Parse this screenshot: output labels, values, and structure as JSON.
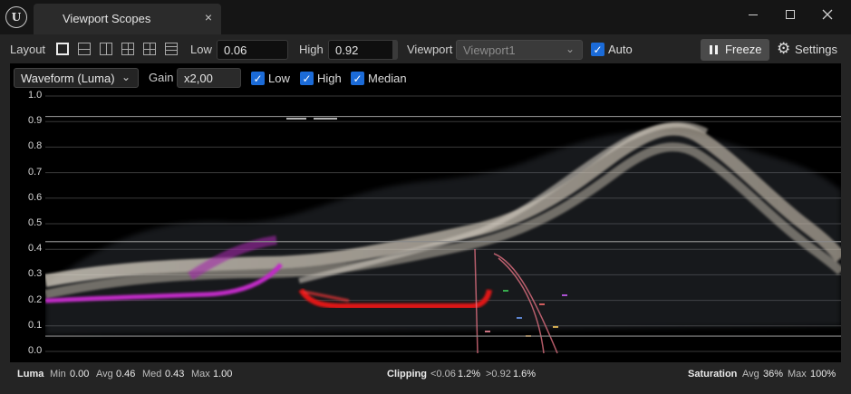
{
  "window": {
    "app_logo": "U",
    "tab_title": "Viewport Scopes",
    "tab_close": "×",
    "controls": [
      "minimize-icon",
      "maximize-icon",
      "close-icon"
    ]
  },
  "toolbar": {
    "layout_label": "Layout",
    "layout_icons": [
      "layout-single-icon",
      "layout-horizontal-split-icon",
      "layout-vertical-split-icon",
      "layout-quad-icon",
      "layout-grid-icon",
      "layout-rows-icon"
    ],
    "low_label": "Low",
    "low_value": "0.06",
    "high_label": "High",
    "high_value": "0.92",
    "viewport_label": "Viewport",
    "viewport_value": "Viewport1",
    "auto_label": "Auto",
    "auto_checked": true,
    "freeze_label": "Freeze",
    "settings_label": "Settings"
  },
  "scope": {
    "mode_value": "Waveform (Luma)",
    "gain_label": "Gain",
    "gain_value": "x2,00",
    "low_label": "Low",
    "high_label": "High",
    "median_label": "Median",
    "low_checked": true,
    "high_checked": true,
    "median_checked": true,
    "y_ticks": [
      "1.0",
      "0.9",
      "0.8",
      "0.7",
      "0.6",
      "0.5",
      "0.4",
      "0.3",
      "0.2",
      "0.1",
      "0.0"
    ]
  },
  "chart_data": {
    "type": "waveform",
    "title": "",
    "ylabel": "",
    "ylim": [
      0,
      1
    ],
    "y_ticks": [
      1.0,
      0.9,
      0.8,
      0.7,
      0.6,
      0.5,
      0.4,
      0.3,
      0.2,
      0.1,
      0.0
    ],
    "reference_lines": {
      "low": 0.06,
      "high": 0.92,
      "median": 0.43
    },
    "series": [
      {
        "color": "#e6ddd0",
        "x": [
          0,
          0.1,
          0.2,
          0.3,
          0.4,
          0.5,
          0.6,
          0.65,
          0.7,
          0.75,
          0.8,
          0.85,
          0.9,
          0.95,
          1.0
        ],
        "y": [
          0.3,
          0.36,
          0.4,
          0.38,
          0.4,
          0.45,
          0.55,
          0.68,
          0.82,
          0.9,
          0.88,
          0.75,
          0.62,
          0.5,
          0.38
        ]
      },
      {
        "color": "#c438c8",
        "x": [
          0,
          0.1,
          0.2,
          0.3
        ],
        "y": [
          0.21,
          0.23,
          0.25,
          0.32
        ]
      },
      {
        "color": "#e01818",
        "x": [
          0.32,
          0.4,
          0.5,
          0.55
        ],
        "y": [
          0.2,
          0.2,
          0.2,
          0.2
        ]
      }
    ]
  },
  "status": {
    "luma_label": "Luma",
    "min_label": "Min",
    "min_value": "0.00",
    "avg_label": "Avg",
    "avg_value": "0.46",
    "med_label": "Med",
    "med_value": "0.43",
    "max_label": "Max",
    "max_value": "1.00",
    "clipping_label": "Clipping",
    "clip_low_label": "<0.06",
    "clip_low_value": "1.2%",
    "clip_high_label": ">0.92",
    "clip_high_value": "1.6%",
    "saturation_label": "Saturation",
    "sat_avg_label": "Avg",
    "sat_avg_value": "36%",
    "sat_max_label": "Max",
    "sat_max_value": "100%"
  }
}
